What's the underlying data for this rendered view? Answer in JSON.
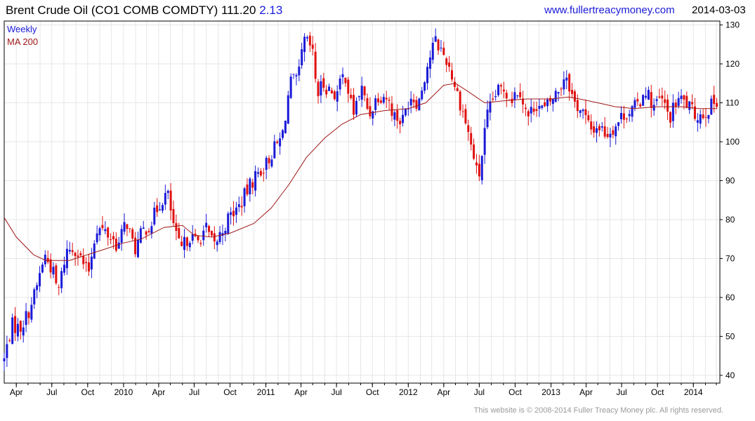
{
  "header": {
    "title": "Brent Crude Oil  (CO1 COMB COMDTY) 111.20",
    "change": "2.13",
    "site": "www.fullertreacymoney.com",
    "date": "2014-03-03"
  },
  "footer": {
    "copyright": "This website is © 2008-2014 Fuller Treacy Money plc. All rights reserved."
  },
  "colors": {
    "up": "#1a1ad8",
    "down": "#e01010",
    "ma": "#a01818",
    "grid": "#e6e6e6",
    "axis": "#000000"
  },
  "chart_data": {
    "type": "candlestick",
    "title": "Brent Crude Oil  (CO1 COMB COMDTY) 111.20 2.13",
    "legend": [
      {
        "name": "Weekly",
        "color": "#1a1ad8"
      },
      {
        "name": "MA 200",
        "color": "#a01818"
      }
    ],
    "legend_position": "top-left",
    "y_axis_position": "right",
    "grid": true,
    "ylim": [
      38,
      131
    ],
    "y_ticks": [
      40,
      50,
      60,
      70,
      80,
      90,
      100,
      110,
      120,
      130
    ],
    "xlim": [
      "2009-03-01",
      "2014-03-10"
    ],
    "x_ticks": [
      {
        "label": "Apr",
        "date": "2009-04-01"
      },
      {
        "label": "Jul",
        "date": "2009-07-01"
      },
      {
        "label": "Oct",
        "date": "2009-10-01"
      },
      {
        "label": "2010",
        "date": "2010-01-01"
      },
      {
        "label": "Apr",
        "date": "2010-04-01"
      },
      {
        "label": "Jul",
        "date": "2010-07-01"
      },
      {
        "label": "Oct",
        "date": "2010-10-01"
      },
      {
        "label": "2011",
        "date": "2011-01-01"
      },
      {
        "label": "Apr",
        "date": "2011-04-01"
      },
      {
        "label": "Jul",
        "date": "2011-07-01"
      },
      {
        "label": "Oct",
        "date": "2011-10-01"
      },
      {
        "label": "2012",
        "date": "2012-01-01"
      },
      {
        "label": "Apr",
        "date": "2012-04-01"
      },
      {
        "label": "Jul",
        "date": "2012-07-01"
      },
      {
        "label": "Oct",
        "date": "2012-10-01"
      },
      {
        "label": "2013",
        "date": "2013-01-01"
      },
      {
        "label": "Apr",
        "date": "2013-04-01"
      },
      {
        "label": "Jul",
        "date": "2013-07-01"
      },
      {
        "label": "Oct",
        "date": "2013-10-01"
      },
      {
        "label": "2014",
        "date": "2014-01-01"
      }
    ],
    "close_path": [
      [
        "2009-03-01",
        44
      ],
      [
        "2009-03-20",
        53
      ],
      [
        "2009-04-10",
        52
      ],
      [
        "2009-05-01",
        56
      ],
      [
        "2009-05-22",
        62
      ],
      [
        "2009-06-12",
        71
      ],
      [
        "2009-07-03",
        67
      ],
      [
        "2009-07-17",
        61
      ],
      [
        "2009-08-07",
        72
      ],
      [
        "2009-08-28",
        73
      ],
      [
        "2009-09-18",
        69
      ],
      [
        "2009-10-02",
        66
      ],
      [
        "2009-10-23",
        78
      ],
      [
        "2009-11-13",
        77
      ],
      [
        "2009-12-04",
        75
      ],
      [
        "2009-12-18",
        73
      ],
      [
        "2010-01-08",
        80
      ],
      [
        "2010-01-29",
        72
      ],
      [
        "2010-02-19",
        77
      ],
      [
        "2010-03-12",
        79
      ],
      [
        "2010-04-02",
        84
      ],
      [
        "2010-04-23",
        87
      ],
      [
        "2010-05-14",
        76
      ],
      [
        "2010-05-28",
        72
      ],
      [
        "2010-06-18",
        76
      ],
      [
        "2010-07-09",
        74
      ],
      [
        "2010-07-30",
        78
      ],
      [
        "2010-08-20",
        73
      ],
      [
        "2010-09-10",
        77
      ],
      [
        "2010-10-01",
        81
      ],
      [
        "2010-10-22",
        83
      ],
      [
        "2010-11-12",
        87
      ],
      [
        "2010-12-03",
        91
      ],
      [
        "2010-12-31",
        94
      ],
      [
        "2011-01-21",
        98
      ],
      [
        "2011-02-11",
        101
      ],
      [
        "2011-03-04",
        115
      ],
      [
        "2011-03-25",
        116
      ],
      [
        "2011-04-08",
        126
      ],
      [
        "2011-04-29",
        124
      ],
      [
        "2011-05-13",
        112
      ],
      [
        "2011-05-27",
        115
      ],
      [
        "2011-06-17",
        113
      ],
      [
        "2011-07-01",
        112
      ],
      [
        "2011-07-22",
        118
      ],
      [
        "2011-08-12",
        107
      ],
      [
        "2011-09-02",
        114
      ],
      [
        "2011-09-23",
        107
      ],
      [
        "2011-10-14",
        112
      ],
      [
        "2011-11-04",
        112
      ],
      [
        "2011-11-25",
        107
      ],
      [
        "2011-12-16",
        105
      ],
      [
        "2012-01-06",
        112
      ],
      [
        "2012-01-27",
        110
      ],
      [
        "2012-02-17",
        119
      ],
      [
        "2012-03-09",
        126
      ],
      [
        "2012-03-23",
        124
      ],
      [
        "2012-04-13",
        120
      ],
      [
        "2012-05-04",
        113
      ],
      [
        "2012-05-25",
        106
      ],
      [
        "2012-06-15",
        97
      ],
      [
        "2012-06-29",
        90
      ],
      [
        "2012-07-20",
        106
      ],
      [
        "2012-08-10",
        112
      ],
      [
        "2012-08-31",
        114
      ],
      [
        "2012-09-21",
        111
      ],
      [
        "2012-10-12",
        114
      ],
      [
        "2012-11-02",
        106
      ],
      [
        "2012-11-23",
        110
      ],
      [
        "2012-12-14",
        108
      ],
      [
        "2013-01-04",
        111
      ],
      [
        "2013-01-25",
        114
      ],
      [
        "2013-02-08",
        118
      ],
      [
        "2013-03-01",
        110
      ],
      [
        "2013-03-22",
        108
      ],
      [
        "2013-04-12",
        103
      ],
      [
        "2013-05-03",
        104
      ],
      [
        "2013-05-24",
        102
      ],
      [
        "2013-06-14",
        104
      ],
      [
        "2013-07-05",
        107
      ],
      [
        "2013-07-26",
        108
      ],
      [
        "2013-08-16",
        110
      ],
      [
        "2013-08-30",
        114
      ],
      [
        "2013-09-20",
        109
      ],
      [
        "2013-10-11",
        111
      ],
      [
        "2013-11-01",
        106
      ],
      [
        "2013-11-22",
        111
      ],
      [
        "2013-12-13",
        110
      ],
      [
        "2014-01-03",
        107
      ],
      [
        "2014-01-24",
        107
      ],
      [
        "2014-02-14",
        109
      ],
      [
        "2014-03-03",
        111
      ]
    ],
    "ma200": [
      [
        "2009-03-01",
        80.5
      ],
      [
        "2009-04-01",
        75.5
      ],
      [
        "2009-05-15",
        71
      ],
      [
        "2009-06-15",
        69.5
      ],
      [
        "2009-08-15",
        69.5
      ],
      [
        "2009-11-01",
        72
      ],
      [
        "2010-01-01",
        74
      ],
      [
        "2010-02-15",
        75
      ],
      [
        "2010-04-15",
        78
      ],
      [
        "2010-06-01",
        78.5
      ],
      [
        "2010-07-01",
        76
      ],
      [
        "2010-08-15",
        75.5
      ],
      [
        "2010-10-01",
        76.5
      ],
      [
        "2010-12-01",
        79
      ],
      [
        "2011-01-15",
        83
      ],
      [
        "2011-03-01",
        89
      ],
      [
        "2011-04-15",
        96
      ],
      [
        "2011-06-01",
        101
      ],
      [
        "2011-07-15",
        104.5
      ],
      [
        "2011-09-01",
        107
      ],
      [
        "2011-11-01",
        108
      ],
      [
        "2012-01-01",
        108.5
      ],
      [
        "2012-02-15",
        110
      ],
      [
        "2012-04-01",
        114.5
      ],
      [
        "2012-05-01",
        115
      ],
      [
        "2012-06-01",
        113
      ],
      [
        "2012-07-15",
        110
      ],
      [
        "2012-09-01",
        110.5
      ],
      [
        "2012-11-01",
        111
      ],
      [
        "2013-01-01",
        111
      ],
      [
        "2013-02-15",
        111.5
      ],
      [
        "2013-03-15",
        111
      ],
      [
        "2013-05-01",
        110
      ],
      [
        "2013-06-15",
        109
      ],
      [
        "2013-08-01",
        108.5
      ],
      [
        "2013-10-01",
        109
      ],
      [
        "2013-12-01",
        109
      ],
      [
        "2014-01-15",
        108.5
      ],
      [
        "2014-03-03",
        108.5
      ]
    ]
  }
}
